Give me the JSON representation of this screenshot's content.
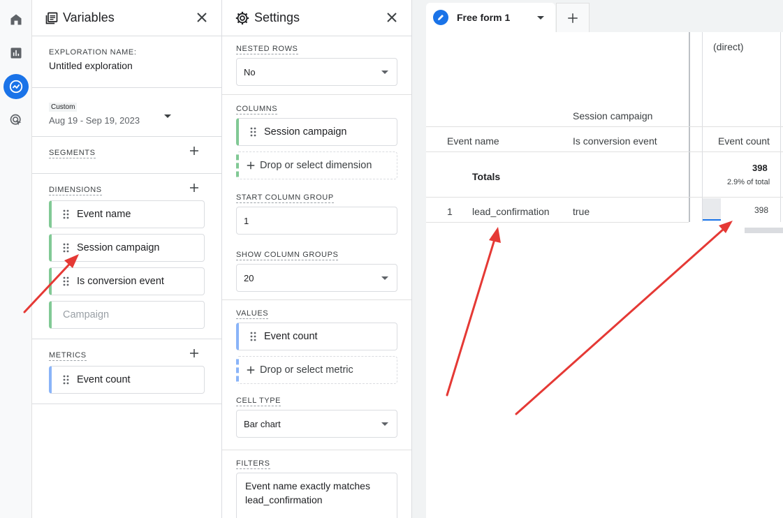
{
  "nav": {
    "icons": [
      "home-icon",
      "reports-icon",
      "explore-icon",
      "advertising-icon"
    ]
  },
  "variables": {
    "title": "Variables",
    "exploration_name_label": "EXPLORATION NAME:",
    "exploration_name": "Untitled exploration",
    "date_badge": "Custom",
    "date_range": "Aug 19 - Sep 19, 2023",
    "segments_label": "SEGMENTS",
    "dimensions_label": "DIMENSIONS",
    "dimensions": [
      "Event name",
      "Session campaign",
      "Is conversion event",
      "Campaign"
    ],
    "metrics_label": "METRICS",
    "metrics": [
      "Event count"
    ]
  },
  "settings": {
    "title": "Settings",
    "nested_rows_label": "NESTED ROWS",
    "nested_rows_value": "No",
    "columns_label": "COLUMNS",
    "column_item": "Session campaign",
    "drop_dimension": "Drop or select dimension",
    "start_column_group_label": "START COLUMN GROUP",
    "start_column_group_value": "1",
    "show_column_groups_label": "SHOW COLUMN GROUPS",
    "show_column_groups_value": "20",
    "values_label": "VALUES",
    "value_item": "Event count",
    "drop_metric": "Drop or select metric",
    "cell_type_label": "CELL TYPE",
    "cell_type_value": "Bar chart",
    "filters_label": "FILTERS",
    "filter_text": "Event name exactly matches lead_confirmation"
  },
  "canvas": {
    "tab_label": "Free form 1",
    "col_group_header": "(direct)",
    "pivot_label": "Session campaign",
    "headers": {
      "event_name": "Event name",
      "is_conversion": "Is conversion event",
      "event_count": "Event count"
    },
    "totals": {
      "label": "Totals",
      "value": "398",
      "pct": "2.9% of total"
    },
    "rows": [
      {
        "index": "1",
        "event_name": "lead_confirmation",
        "is_conversion": "true",
        "event_count": "398"
      }
    ]
  },
  "colors": {
    "accent": "#1a73e8",
    "dimension": "#81c995",
    "metric": "#8ab4f8",
    "annotation": "#e53935"
  }
}
